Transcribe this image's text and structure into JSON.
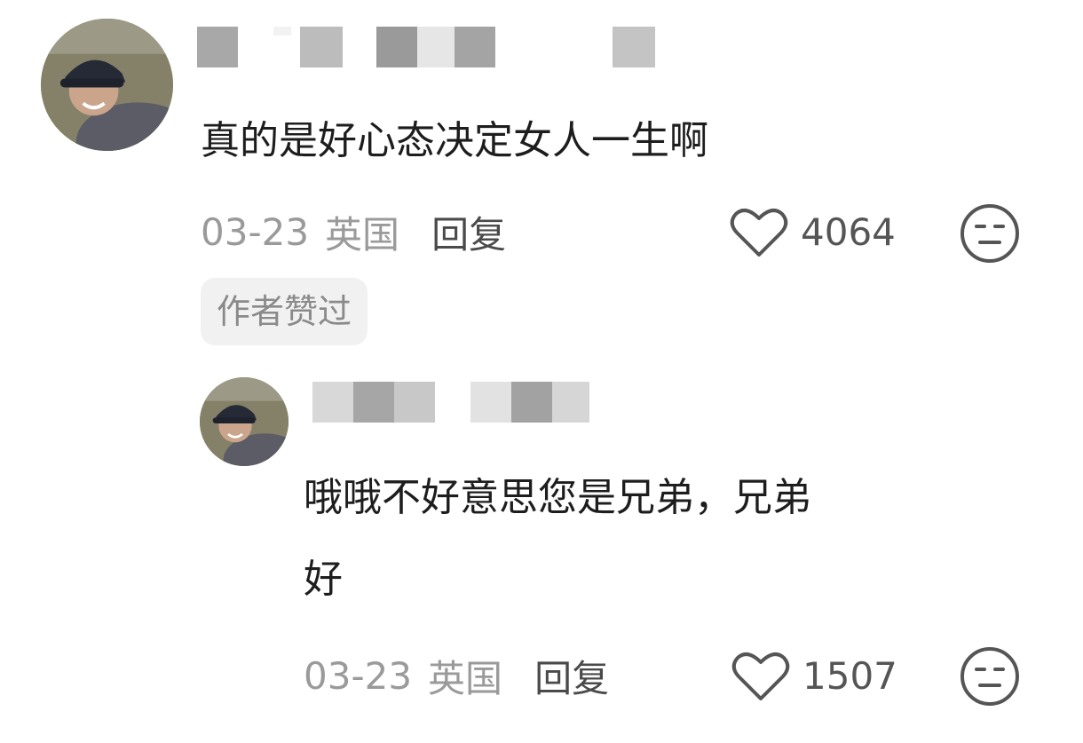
{
  "colors": {
    "meta": "#9a9a9a",
    "text": "#1d1d1d",
    "badge_bg": "#f1f1f1"
  },
  "comments": [
    {
      "text": "真的是好心态决定女人一生啊",
      "date": "03-23",
      "location": "英国",
      "reply_label": "回复",
      "likes": "4064",
      "badge": "作者赞过",
      "avatar_icon": "user-avatar-photo",
      "like_icon": "heart-outline-icon",
      "emoji_icon": "expressionless-face-icon"
    },
    {
      "text_line1": "哦哦不好意思您是兄弟，兄弟",
      "text_line2": "好",
      "date": "03-23",
      "location": "英国",
      "reply_label": "回复",
      "likes": "1507",
      "avatar_icon": "user-avatar-photo",
      "like_icon": "heart-outline-icon",
      "emoji_icon": "expressionless-face-icon"
    }
  ]
}
